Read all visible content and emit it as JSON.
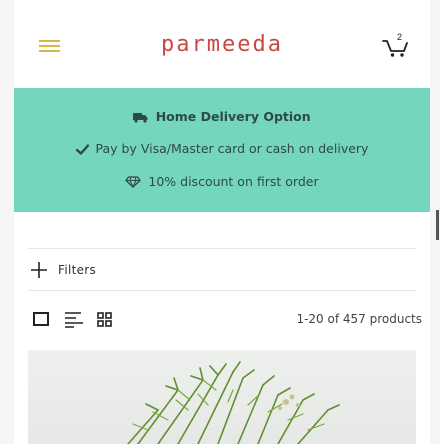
{
  "header": {
    "logo_text": "parmeeda",
    "cart_count": "2"
  },
  "banner": {
    "background_color": "#74d6bf",
    "lines": [
      {
        "icon": "truck-icon",
        "text": "Home Delivery Option"
      },
      {
        "icon": "check-icon",
        "text": "Pay by Visa/Master card or cash on delivery"
      },
      {
        "icon": "diamond-icon",
        "text": "10% discount on first order"
      }
    ]
  },
  "filters": {
    "label": "Filters"
  },
  "toolbar": {
    "view_icons": [
      "single-view-icon",
      "list-view-icon",
      "grid-view-icon"
    ],
    "product_count": "1-20 of 457 products"
  },
  "colors": {
    "brand": "#c64a42",
    "menu": "#d8b64a"
  }
}
